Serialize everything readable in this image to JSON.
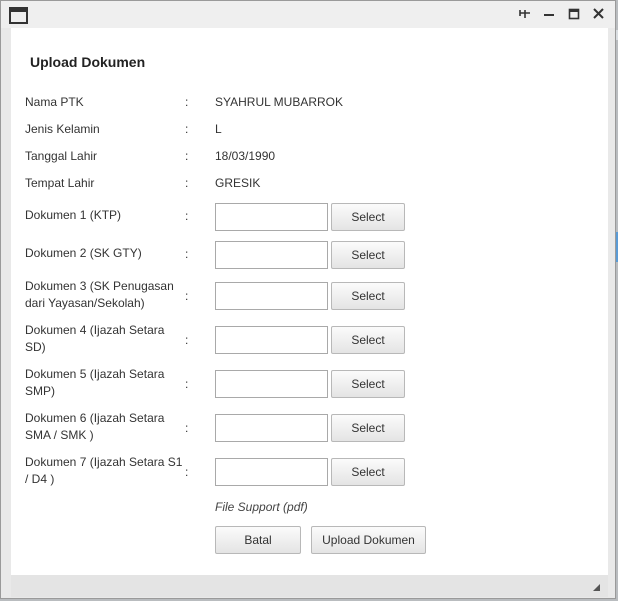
{
  "dialog": {
    "title": "Upload Dokumen"
  },
  "colon": ":",
  "info": [
    {
      "label": "Nama PTK",
      "value": "SYAHRUL MUBARROK"
    },
    {
      "label": "Jenis Kelamin",
      "value": "L"
    },
    {
      "label": "Tanggal Lahir",
      "value": "18/03/1990"
    },
    {
      "label": "Tempat Lahir",
      "value": "GRESIK"
    }
  ],
  "documents": [
    {
      "label": "Dokumen 1 (KTP)",
      "button": "Select"
    },
    {
      "label": "Dokumen 2 (SK GTY)",
      "button": "Select"
    },
    {
      "label": "Dokumen 3 (SK Penugasan dari Yayasan/Sekolah)",
      "button": "Select"
    },
    {
      "label": "Dokumen 4 (Ijazah Setara SD)",
      "button": "Select"
    },
    {
      "label": "Dokumen 5 (Ijazah Setara SMP)",
      "button": "Select"
    },
    {
      "label": "Dokumen 6 (Ijazah Setara SMA / SMK )",
      "button": "Select"
    },
    {
      "label": "Dokumen 7 (Ijazah Setara S1 / D4 )",
      "button": "Select"
    }
  ],
  "hint": "File Support (pdf)",
  "actions": {
    "cancel": "Batal",
    "upload": "Upload Dokumen"
  },
  "icons": {
    "window": "window-icon",
    "pin": "pin-icon",
    "minimize": "minimize-icon",
    "maximize": "maximize-icon",
    "close": "close-icon",
    "resize": "resize-grip-icon"
  }
}
